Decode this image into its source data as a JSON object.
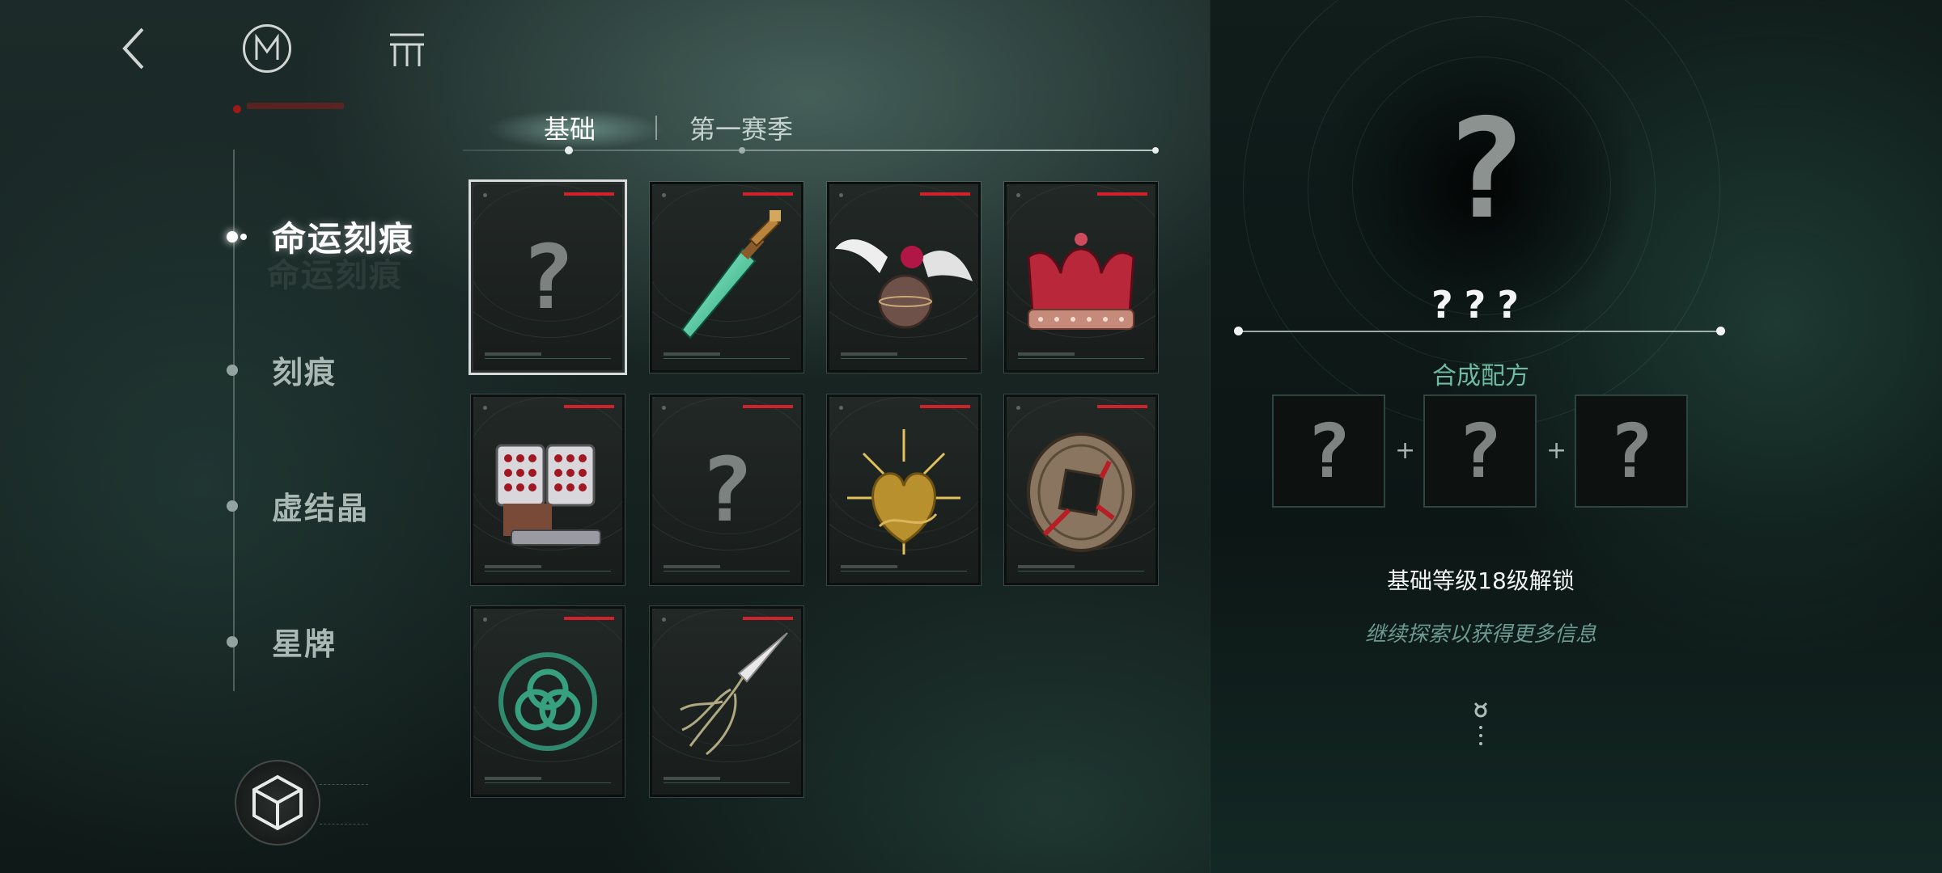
{
  "nav": {
    "items": [
      {
        "label": "命运刻痕",
        "active": true
      },
      {
        "label": "刻痕",
        "active": false
      },
      {
        "label": "虚结晶",
        "active": false
      },
      {
        "label": "星牌",
        "active": false
      }
    ]
  },
  "tabs": [
    {
      "label": "基础",
      "active": true
    },
    {
      "label": "第一赛季",
      "active": false
    }
  ],
  "grid": {
    "cards": [
      {
        "item": "unknown",
        "icon": "question-mark-icon",
        "selected": true
      },
      {
        "item": "green-glowing-blade",
        "icon": "sword-icon",
        "selected": false
      },
      {
        "item": "winged-orb",
        "icon": "winged-orb-icon",
        "selected": false
      },
      {
        "item": "red-crown",
        "icon": "crown-icon",
        "selected": false
      },
      {
        "item": "rocket-launcher",
        "icon": "rocket-launcher-icon",
        "selected": false
      },
      {
        "item": "unknown",
        "icon": "question-mark-icon",
        "selected": false
      },
      {
        "item": "golden-heart",
        "icon": "golden-heart-icon",
        "selected": false
      },
      {
        "item": "ancient-coin",
        "icon": "coin-icon",
        "selected": false
      },
      {
        "item": "green-knot-emblem",
        "icon": "knot-emblem-icon",
        "selected": false
      },
      {
        "item": "vine-spear",
        "icon": "spear-icon",
        "selected": false
      }
    ],
    "question_glyph": "?"
  },
  "detail": {
    "big_icon": "?",
    "name": "???",
    "recipe_title": "合成配方",
    "recipe_slots": [
      "?",
      "?",
      "?"
    ],
    "plus": "+",
    "unlock_text": "基础等级18级解锁",
    "hint_text": "继续探索以获得更多信息"
  },
  "colors": {
    "accent_green": "#6fbb9f",
    "card_red_bar": "#d0222b",
    "text_primary": "#f2f5f4"
  }
}
